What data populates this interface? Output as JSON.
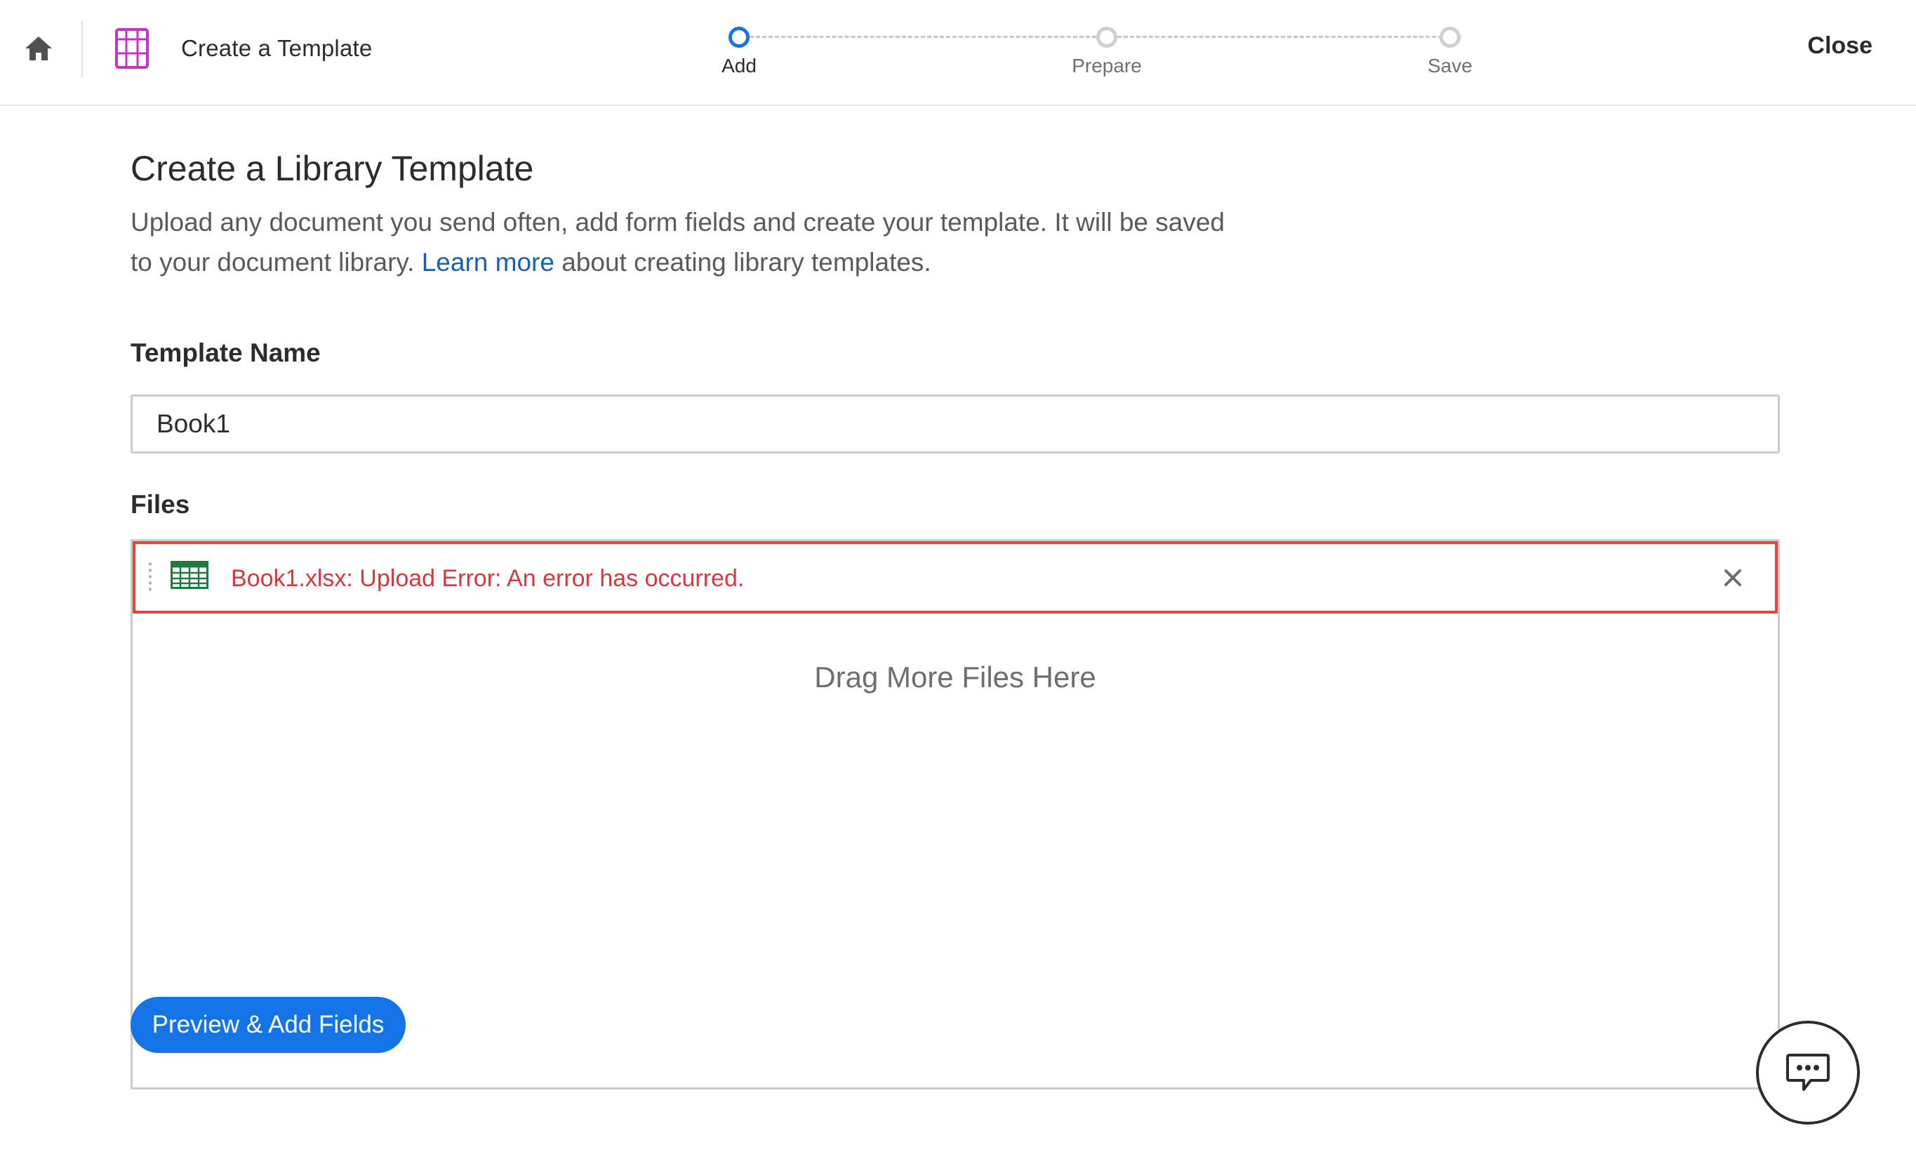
{
  "header": {
    "home_icon": "home-icon",
    "template_icon": "template-icon",
    "title": "Create a Template",
    "close_label": "Close"
  },
  "stepper": {
    "steps": [
      {
        "label": "Add",
        "state": "active"
      },
      {
        "label": "Prepare",
        "state": "inactive"
      },
      {
        "label": "Save",
        "state": "inactive"
      }
    ]
  },
  "main": {
    "title": "Create a Library Template",
    "description_before": "Upload any document you send often, add form fields and create your template. It will be saved to your document library. ",
    "learn_more": "Learn more",
    "description_after": " about creating library templates.",
    "template_name_label": "Template Name",
    "template_name_value": "Book1",
    "files_label": "Files",
    "file_error": "Book1.xlsx: Upload Error: An error has occurred.",
    "file_icon": "spreadsheet-icon",
    "drag_text": "Drag More Files Here",
    "primary_button": "Preview & Add Fields"
  },
  "chat": {
    "icon": "chat-bubble-icon"
  },
  "colors": {
    "accent": "#1473e6",
    "error": "#d7373f",
    "link": "#1a5fb4",
    "template_icon": "#c534c4",
    "spreadsheet_icon": "#1f7a3d"
  }
}
